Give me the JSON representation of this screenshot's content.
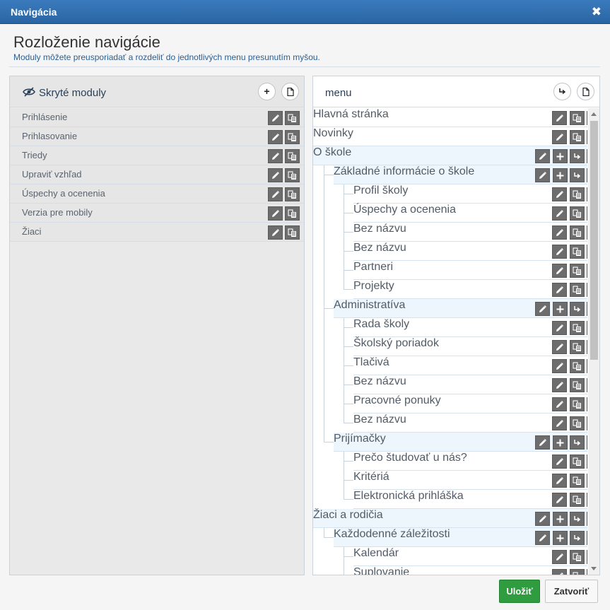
{
  "window": {
    "title": "Navigácia",
    "close_glyph": "✖"
  },
  "header": {
    "title": "Rozloženie navigácie",
    "subtitle": "Moduly môžete preusporiadať a rozdeliť do jednotlivých menu presunutím myšou."
  },
  "hidden_panel": {
    "title": "Skryté moduly",
    "add_glyph": "+",
    "items": [
      {
        "label": "Prihlásenie"
      },
      {
        "label": "Prihlasovanie"
      },
      {
        "label": "Triedy"
      },
      {
        "label": "Upraviť vzhľad"
      },
      {
        "label": "Úspechy a ocenenia"
      },
      {
        "label": "Verzia pre mobily"
      },
      {
        "label": "Žiaci"
      }
    ]
  },
  "menu_panel": {
    "title": "menu",
    "items": [
      {
        "label": "Hlavná stránka",
        "level": 0,
        "group": false
      },
      {
        "label": "Novinky",
        "level": 0,
        "group": false
      },
      {
        "label": "O škole",
        "level": 0,
        "group": true
      },
      {
        "label": "Základné informácie o škole",
        "level": 1,
        "group": true
      },
      {
        "label": "Profil školy",
        "level": 2,
        "group": false
      },
      {
        "label": "Úspechy a ocenenia",
        "level": 2,
        "group": false
      },
      {
        "label": "Bez názvu",
        "level": 2,
        "group": false
      },
      {
        "label": "Bez názvu",
        "level": 2,
        "group": false
      },
      {
        "label": "Partneri",
        "level": 2,
        "group": false
      },
      {
        "label": "Projekty",
        "level": 2,
        "group": false
      },
      {
        "label": "Administratíva",
        "level": 1,
        "group": true
      },
      {
        "label": "Rada školy",
        "level": 2,
        "group": false
      },
      {
        "label": "Školský poriadok",
        "level": 2,
        "group": false
      },
      {
        "label": "Tlačivá",
        "level": 2,
        "group": false
      },
      {
        "label": "Bez názvu",
        "level": 2,
        "group": false
      },
      {
        "label": "Pracovné ponuky",
        "level": 2,
        "group": false
      },
      {
        "label": "Bez názvu",
        "level": 2,
        "group": false
      },
      {
        "label": "Prijímačky",
        "level": 1,
        "group": true
      },
      {
        "label": "Prečo študovať u nás?",
        "level": 2,
        "group": false
      },
      {
        "label": "Kritériá",
        "level": 2,
        "group": false
      },
      {
        "label": "Elektronická prihláška",
        "level": 2,
        "group": false
      },
      {
        "label": "Žiaci a rodičia",
        "level": 0,
        "group": true
      },
      {
        "label": "Každodenné záležitosti",
        "level": 1,
        "group": true
      },
      {
        "label": "Kalendár",
        "level": 2,
        "group": false
      },
      {
        "label": "Suplovanie",
        "level": 2,
        "group": false
      }
    ]
  },
  "footer": {
    "save_label": "Uložiť",
    "close_label": "Zatvoriť"
  },
  "colors": {
    "titlebar": "#2f6fae",
    "save": "#2e9c3f",
    "icon_button": "#6d6d6d"
  }
}
